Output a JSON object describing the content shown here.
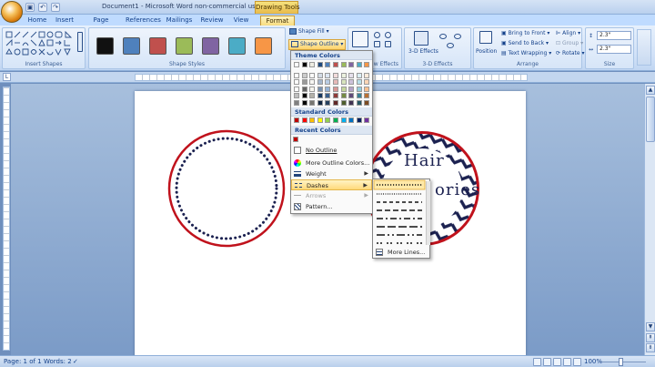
{
  "window": {
    "title": "Document1 - Microsoft Word non-commercial use",
    "contextual_tab": "Drawing Tools"
  },
  "quick_access": [
    {
      "name": "save-icon",
      "glyph": "▣"
    },
    {
      "name": "undo-icon",
      "glyph": "↶"
    },
    {
      "name": "redo-icon",
      "glyph": "↷"
    }
  ],
  "tabs": [
    "Home",
    "Insert",
    "Page Layout",
    "References",
    "Mailings",
    "Review",
    "View",
    "Format"
  ],
  "active_tab": "Format",
  "ribbon": {
    "insert_shapes_label": "Insert Shapes",
    "shape_styles_label": "Shape Styles",
    "shape_style_colors": [
      "#111111",
      "#4f81bd",
      "#c0504d",
      "#9bbb59",
      "#8064a2",
      "#4bacc6",
      "#f79646"
    ],
    "shape_fill": "Shape Fill",
    "shape_outline": "Shape Outline",
    "effects_label": "w Effects",
    "three_d_effects": "3-D Effects",
    "three_d_group": "3-D Effects",
    "position": "Position",
    "bring_to_front": "Bring to Front",
    "send_to_back": "Send to Back",
    "text_wrapping": "Text Wrapping",
    "align": "Align",
    "group": "Group",
    "rotate": "Rotate",
    "arrange_label": "Arrange",
    "height_value": "2.3\"",
    "width_value": "2.3\"",
    "size_label": "Size"
  },
  "outline_menu": {
    "theme_colors_header": "Theme Colors",
    "theme_top_row": [
      "#ffffff",
      "#000000",
      "#eeece1",
      "#1f497d",
      "#4f81bd",
      "#c0504d",
      "#9bbb59",
      "#8064a2",
      "#4bacc6",
      "#f79646"
    ],
    "standard_colors_header": "Standard Colors",
    "standard_colors": [
      "#c00000",
      "#ff0000",
      "#ffc000",
      "#ffff00",
      "#92d050",
      "#00b050",
      "#00b0f0",
      "#0070c0",
      "#002060",
      "#7030a0"
    ],
    "recent_colors_header": "Recent Colors",
    "recent_colors": [
      "#c00000"
    ],
    "items": [
      {
        "label": "No Outline",
        "icon": "no-outline-icon"
      },
      {
        "label": "More Outline Colors...",
        "icon": "palette-icon"
      },
      {
        "label": "Weight",
        "icon": "weight-icon",
        "submenu": true
      },
      {
        "label": "Dashes",
        "icon": "dashes-icon",
        "submenu": true,
        "highlighted": true
      },
      {
        "label": "Arrows",
        "icon": "arrows-icon",
        "submenu": true,
        "disabled": true
      },
      {
        "label": "Pattern...",
        "icon": "pattern-icon"
      }
    ]
  },
  "dashes_menu": {
    "more_lines": "More Lines..."
  },
  "document": {
    "shape2_line1": "Hair",
    "shape2_line2": "ories"
  },
  "status": {
    "page": "Page: 1 of 1",
    "words": "Words: 2",
    "zoom": "100%"
  }
}
